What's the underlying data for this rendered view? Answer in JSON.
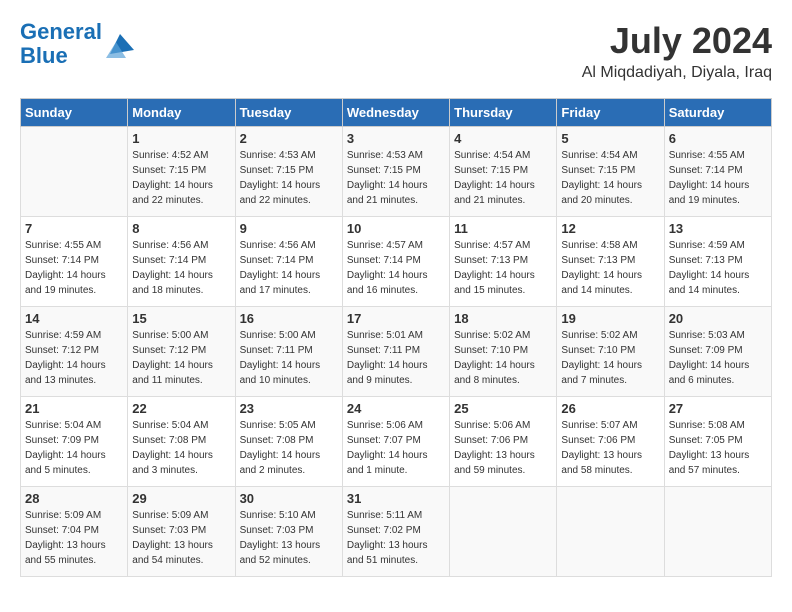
{
  "header": {
    "logo_line1": "General",
    "logo_line2": "Blue",
    "month": "July 2024",
    "location": "Al Miqdadiyah, Diyala, Iraq"
  },
  "days_of_week": [
    "Sunday",
    "Monday",
    "Tuesday",
    "Wednesday",
    "Thursday",
    "Friday",
    "Saturday"
  ],
  "weeks": [
    [
      {
        "day": "",
        "info": ""
      },
      {
        "day": "1",
        "info": "Sunrise: 4:52 AM\nSunset: 7:15 PM\nDaylight: 14 hours\nand 22 minutes."
      },
      {
        "day": "2",
        "info": "Sunrise: 4:53 AM\nSunset: 7:15 PM\nDaylight: 14 hours\nand 22 minutes."
      },
      {
        "day": "3",
        "info": "Sunrise: 4:53 AM\nSunset: 7:15 PM\nDaylight: 14 hours\nand 21 minutes."
      },
      {
        "day": "4",
        "info": "Sunrise: 4:54 AM\nSunset: 7:15 PM\nDaylight: 14 hours\nand 21 minutes."
      },
      {
        "day": "5",
        "info": "Sunrise: 4:54 AM\nSunset: 7:15 PM\nDaylight: 14 hours\nand 20 minutes."
      },
      {
        "day": "6",
        "info": "Sunrise: 4:55 AM\nSunset: 7:14 PM\nDaylight: 14 hours\nand 19 minutes."
      }
    ],
    [
      {
        "day": "7",
        "info": "Sunrise: 4:55 AM\nSunset: 7:14 PM\nDaylight: 14 hours\nand 19 minutes."
      },
      {
        "day": "8",
        "info": "Sunrise: 4:56 AM\nSunset: 7:14 PM\nDaylight: 14 hours\nand 18 minutes."
      },
      {
        "day": "9",
        "info": "Sunrise: 4:56 AM\nSunset: 7:14 PM\nDaylight: 14 hours\nand 17 minutes."
      },
      {
        "day": "10",
        "info": "Sunrise: 4:57 AM\nSunset: 7:14 PM\nDaylight: 14 hours\nand 16 minutes."
      },
      {
        "day": "11",
        "info": "Sunrise: 4:57 AM\nSunset: 7:13 PM\nDaylight: 14 hours\nand 15 minutes."
      },
      {
        "day": "12",
        "info": "Sunrise: 4:58 AM\nSunset: 7:13 PM\nDaylight: 14 hours\nand 14 minutes."
      },
      {
        "day": "13",
        "info": "Sunrise: 4:59 AM\nSunset: 7:13 PM\nDaylight: 14 hours\nand 14 minutes."
      }
    ],
    [
      {
        "day": "14",
        "info": "Sunrise: 4:59 AM\nSunset: 7:12 PM\nDaylight: 14 hours\nand 13 minutes."
      },
      {
        "day": "15",
        "info": "Sunrise: 5:00 AM\nSunset: 7:12 PM\nDaylight: 14 hours\nand 11 minutes."
      },
      {
        "day": "16",
        "info": "Sunrise: 5:00 AM\nSunset: 7:11 PM\nDaylight: 14 hours\nand 10 minutes."
      },
      {
        "day": "17",
        "info": "Sunrise: 5:01 AM\nSunset: 7:11 PM\nDaylight: 14 hours\nand 9 minutes."
      },
      {
        "day": "18",
        "info": "Sunrise: 5:02 AM\nSunset: 7:10 PM\nDaylight: 14 hours\nand 8 minutes."
      },
      {
        "day": "19",
        "info": "Sunrise: 5:02 AM\nSunset: 7:10 PM\nDaylight: 14 hours\nand 7 minutes."
      },
      {
        "day": "20",
        "info": "Sunrise: 5:03 AM\nSunset: 7:09 PM\nDaylight: 14 hours\nand 6 minutes."
      }
    ],
    [
      {
        "day": "21",
        "info": "Sunrise: 5:04 AM\nSunset: 7:09 PM\nDaylight: 14 hours\nand 5 minutes."
      },
      {
        "day": "22",
        "info": "Sunrise: 5:04 AM\nSunset: 7:08 PM\nDaylight: 14 hours\nand 3 minutes."
      },
      {
        "day": "23",
        "info": "Sunrise: 5:05 AM\nSunset: 7:08 PM\nDaylight: 14 hours\nand 2 minutes."
      },
      {
        "day": "24",
        "info": "Sunrise: 5:06 AM\nSunset: 7:07 PM\nDaylight: 14 hours\nand 1 minute."
      },
      {
        "day": "25",
        "info": "Sunrise: 5:06 AM\nSunset: 7:06 PM\nDaylight: 13 hours\nand 59 minutes."
      },
      {
        "day": "26",
        "info": "Sunrise: 5:07 AM\nSunset: 7:06 PM\nDaylight: 13 hours\nand 58 minutes."
      },
      {
        "day": "27",
        "info": "Sunrise: 5:08 AM\nSunset: 7:05 PM\nDaylight: 13 hours\nand 57 minutes."
      }
    ],
    [
      {
        "day": "28",
        "info": "Sunrise: 5:09 AM\nSunset: 7:04 PM\nDaylight: 13 hours\nand 55 minutes."
      },
      {
        "day": "29",
        "info": "Sunrise: 5:09 AM\nSunset: 7:03 PM\nDaylight: 13 hours\nand 54 minutes."
      },
      {
        "day": "30",
        "info": "Sunrise: 5:10 AM\nSunset: 7:03 PM\nDaylight: 13 hours\nand 52 minutes."
      },
      {
        "day": "31",
        "info": "Sunrise: 5:11 AM\nSunset: 7:02 PM\nDaylight: 13 hours\nand 51 minutes."
      },
      {
        "day": "",
        "info": ""
      },
      {
        "day": "",
        "info": ""
      },
      {
        "day": "",
        "info": ""
      }
    ]
  ]
}
